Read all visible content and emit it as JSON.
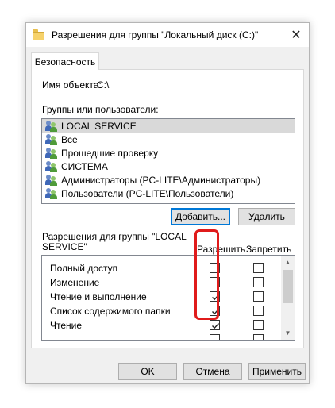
{
  "window": {
    "title": "Разрешения для группы \"Локальный диск (C:)\"",
    "close_glyph": "✕"
  },
  "tabs": [
    {
      "label": "Безопасность"
    }
  ],
  "object": {
    "label": "Имя объекта:",
    "value": "C:\\"
  },
  "groups": {
    "label": "Группы или пользователи:",
    "items": [
      {
        "label": "LOCAL SERVICE",
        "icon": "users-icon",
        "selected": true
      },
      {
        "label": "Все",
        "icon": "users-icon"
      },
      {
        "label": "Прошедшие проверку",
        "icon": "users-icon"
      },
      {
        "label": "СИСТЕМА",
        "icon": "users-icon"
      },
      {
        "label": "Администраторы (PC-LITE\\Администраторы)",
        "icon": "users-icon"
      },
      {
        "label": "Пользователи (PC-LITE\\Пользователи)",
        "icon": "users-icon"
      }
    ],
    "add_label": "Добавить...",
    "remove_label": "Удалить"
  },
  "permissions": {
    "title_line1": "Разрешения для группы \"LOCAL",
    "title_line2": "SERVICE\"",
    "allow_label": "Разрешить",
    "deny_label": "Запретить",
    "rows": [
      {
        "name": "Полный доступ",
        "allow": false,
        "deny": false
      },
      {
        "name": "Изменение",
        "allow": false,
        "deny": false
      },
      {
        "name": "Чтение и выполнение",
        "allow": true,
        "deny": false
      },
      {
        "name": "Список содержимого папки",
        "allow": true,
        "deny": false
      },
      {
        "name": "Чтение",
        "allow": true,
        "deny": false
      },
      {
        "name": "",
        "allow": false,
        "deny": false
      }
    ]
  },
  "footer": {
    "ok_label": "OK",
    "cancel_label": "Отмена",
    "apply_label": "Применить"
  },
  "colors": {
    "highlight": "#e01b1b",
    "focus": "#0078d7"
  }
}
